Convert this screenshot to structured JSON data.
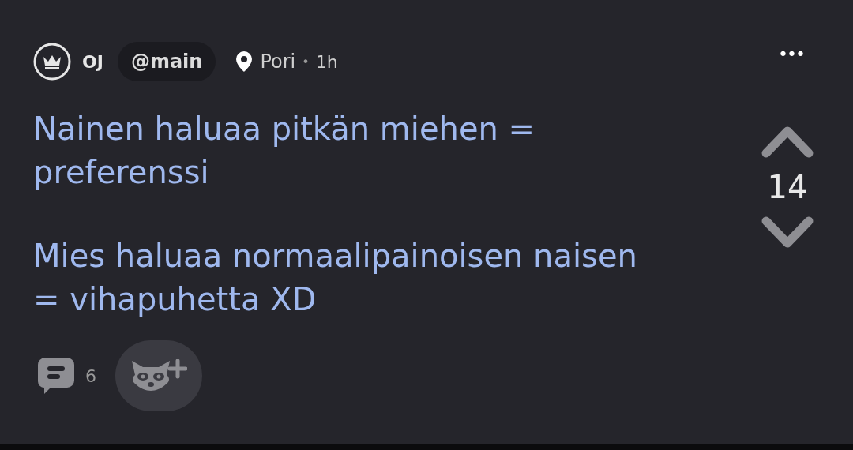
{
  "post": {
    "author": "OJ",
    "channel": "@main",
    "location": "Pori",
    "separator": "•",
    "age": "1h",
    "more": "•••",
    "paragraphs": [
      "Nainen haluaa pitkän miehen = preferenssi",
      "Mies haluaa normaalipainoisen naisen = vihapuhetta XD"
    ],
    "votes": "14",
    "comments": "6"
  }
}
